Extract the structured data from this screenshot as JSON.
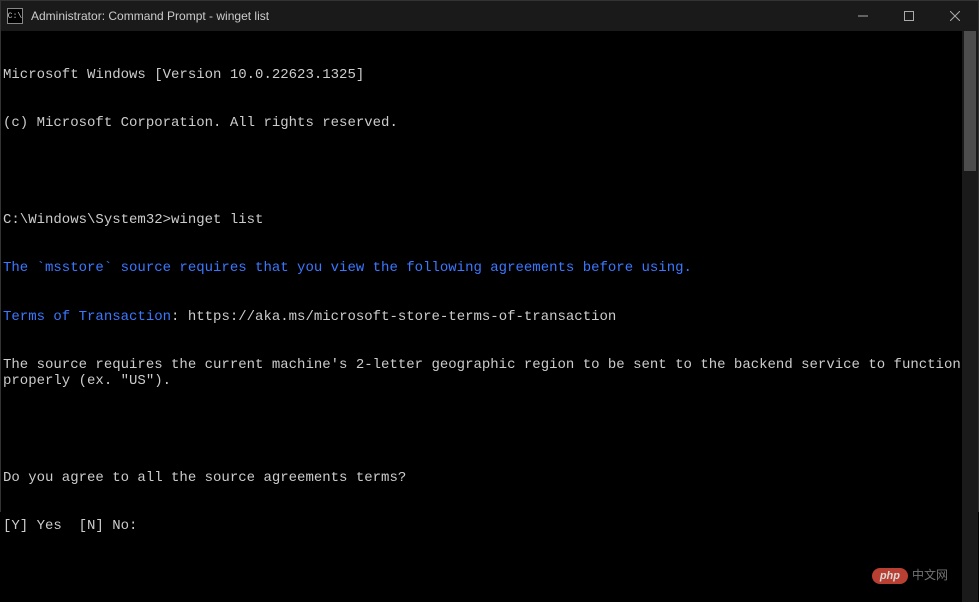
{
  "window": {
    "title": "Administrator: Command Prompt - winget  list",
    "icon_label": "C:\\"
  },
  "terminal": {
    "header1": "Microsoft Windows [Version 10.0.22623.1325]",
    "header2": "(c) Microsoft Corporation. All rights reserved.",
    "prompt": "C:\\Windows\\System32>",
    "command": "winget list",
    "msg1": "The `msstore` source requires that you view the following agreements before using.",
    "terms_label": "Terms of Transaction",
    "terms_sep": ": ",
    "terms_url": "https://aka.ms/microsoft-store-terms-of-transaction",
    "msg2": "The source requires the current machine's 2-letter geographic region to be sent to the backend service to function properly (ex. \"US\").",
    "question": "Do you agree to all the source agreements terms?",
    "options": "[Y] Yes  [N] No: "
  },
  "watermark": {
    "badge": "php",
    "text": "中文网"
  }
}
